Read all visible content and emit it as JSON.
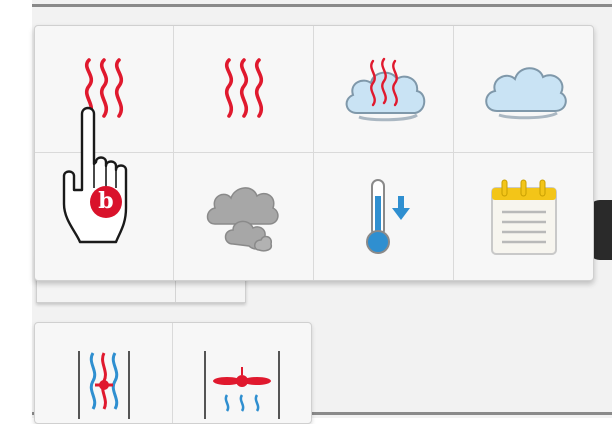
{
  "icons": {
    "row1": [
      "heat-waves-icon",
      "heat-waves-icon",
      "steam-cloud-icon",
      "cloud-icon"
    ],
    "row2": [
      "partial-gauge-icon",
      "smoke-icon",
      "thermometer-down-icon",
      "notepad-icon"
    ],
    "lower": [
      "fan-mixed-icon",
      "fan-heat-icon"
    ]
  },
  "pointer": {
    "badge_text": "b"
  },
  "colors": {
    "heat_red": "#e0192e",
    "cloud_blue": "#c9e3f4",
    "cloud_outline": "#7f98aa",
    "smoke_gray": "#a7a7a7",
    "thermo_blue": "#2f8fd0",
    "notepad_yellow": "#f3c518",
    "badge_red": "#d9122b"
  }
}
